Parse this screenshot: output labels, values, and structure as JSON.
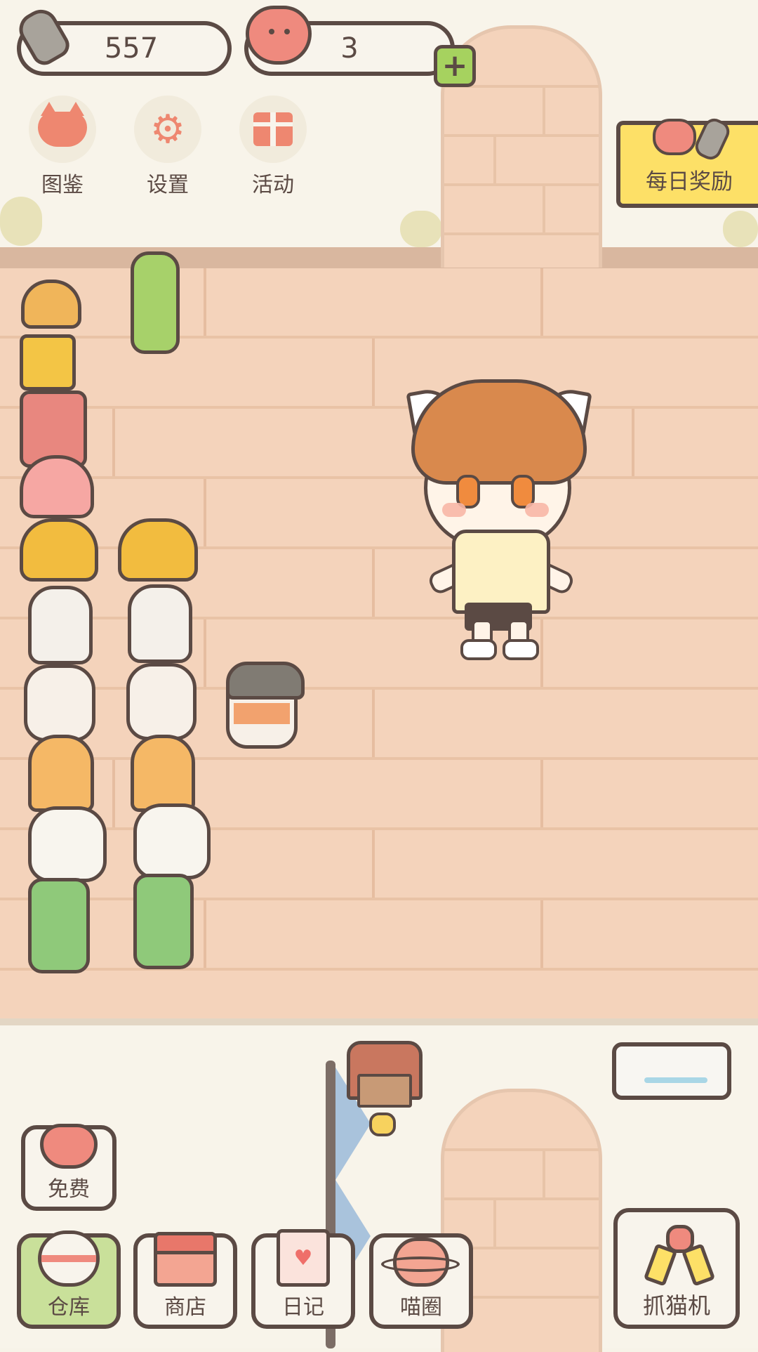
{
  "hud": {
    "fish_count": "557",
    "heart_count": "3",
    "plus_label": "+"
  },
  "menu": {
    "items": [
      {
        "label": "图鉴",
        "icon": "cat-head-icon"
      },
      {
        "label": "设置",
        "icon": "gear-icon"
      },
      {
        "label": "活动",
        "icon": "gift-icon"
      }
    ]
  },
  "daily_reward": {
    "label": "每日奖励"
  },
  "free_button": {
    "label": "免费"
  },
  "bottom_nav": {
    "items": [
      {
        "label": "仓库",
        "icon": "warehouse-icon"
      },
      {
        "label": "商店",
        "icon": "shop-icon"
      },
      {
        "label": "日记",
        "icon": "diary-icon"
      },
      {
        "label": "喵圈",
        "icon": "planet-cat-icon"
      }
    ]
  },
  "claw_machine": {
    "label": "抓猫机"
  },
  "colors": {
    "outline": "#5b4a44",
    "floor": "#f4d3bb",
    "wall": "#f8f4ea",
    "accent_heart": "#ef8a7e",
    "flag_yellow": "#fde067",
    "plus_green": "#a6d25f"
  }
}
